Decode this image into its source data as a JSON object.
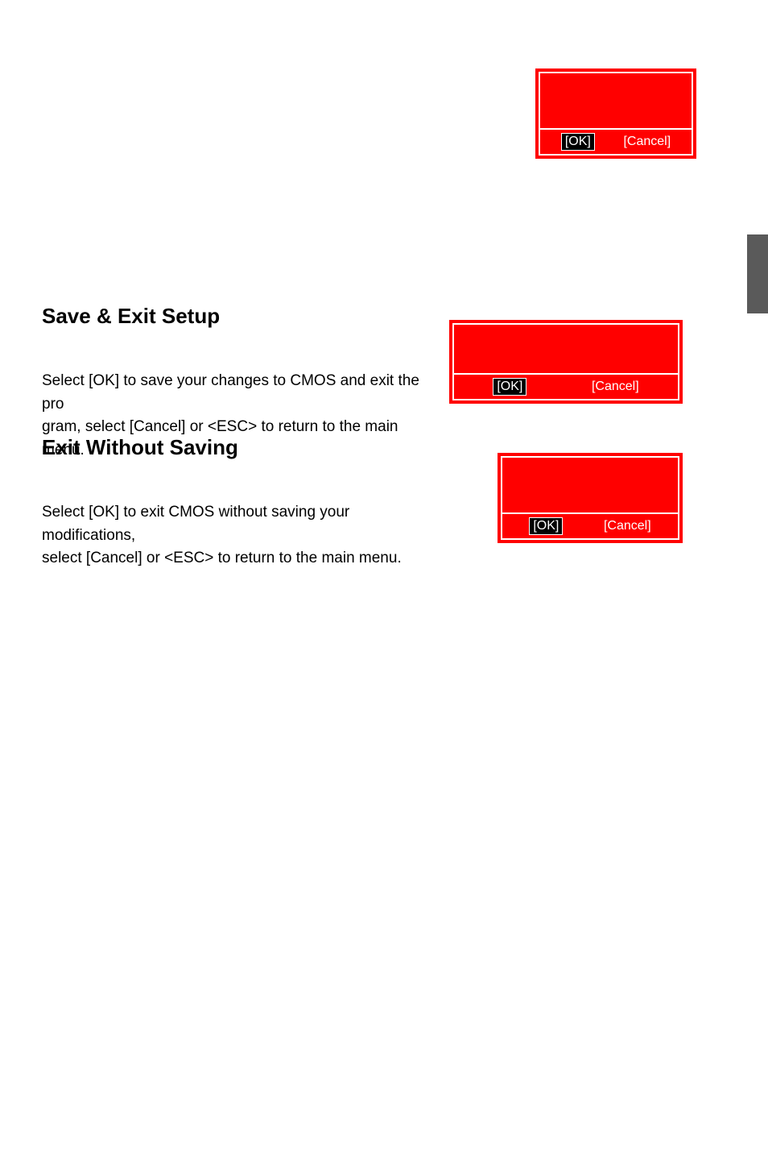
{
  "dialogs": {
    "top": {
      "ok_label": "[OK]",
      "cancel_label": "[Cancel]"
    },
    "save_exit": {
      "ok_label": "[OK]",
      "cancel_label": "[Cancel]"
    },
    "exit_nosave": {
      "ok_label": "[OK]",
      "cancel_label": "[Cancel]"
    }
  },
  "sections": {
    "save_exit": {
      "heading": "Save & Exit Setup",
      "paragraph_line1": "Select [OK] to save your changes to CMOS and exit the pro",
      "paragraph_line2": "gram, select [Cancel] or <ESC> to return to the main menu."
    },
    "exit_nosave": {
      "heading": "Exit Without Saving",
      "paragraph_line1": "Select [OK] to exit CMOS without saving your modifications,",
      "paragraph_line2": "select [Cancel] or <ESC> to return to the main menu."
    }
  }
}
